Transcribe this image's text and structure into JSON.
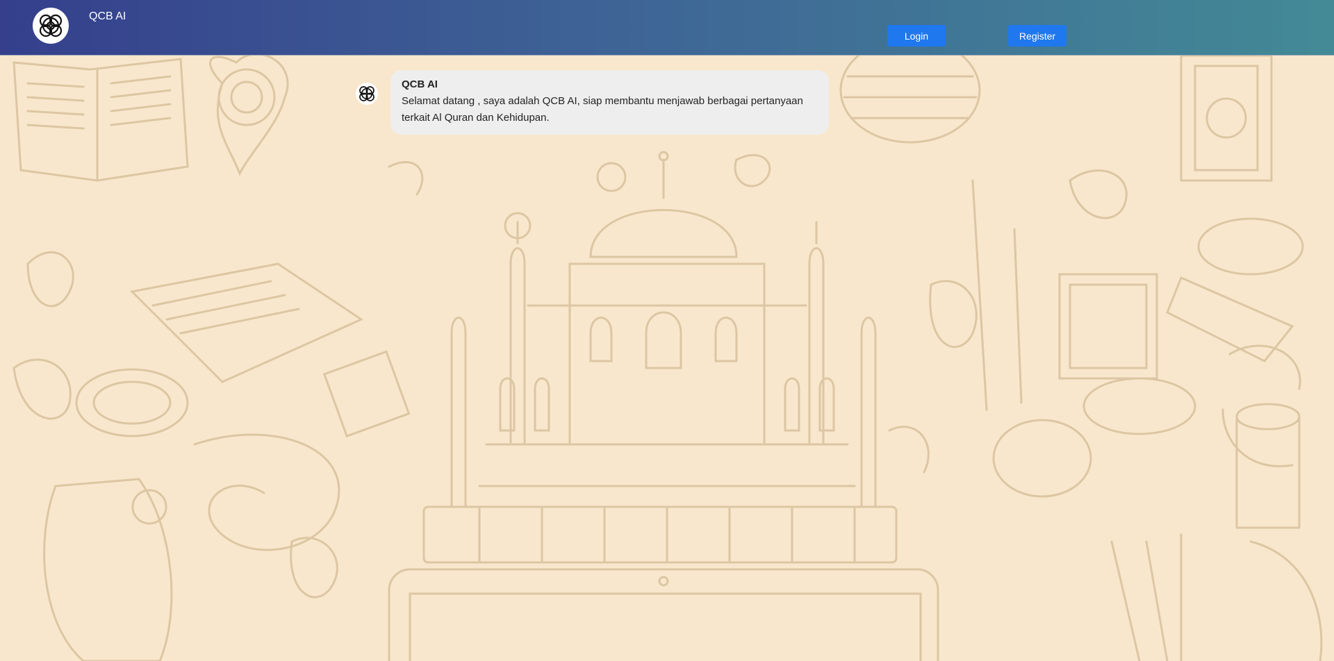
{
  "header": {
    "app_title": "QCB AI",
    "logo_icon": "knot-logo-icon",
    "login_label": "Login",
    "register_label": "Register",
    "gradient_colors": [
      "#353f8c",
      "#3e6396",
      "#438a96"
    ],
    "button_color": "#1f78ee"
  },
  "chat": {
    "messages": [
      {
        "sender": "QCB AI",
        "avatar_icon": "knot-logo-icon",
        "text": "Selamat datang , saya adalah QCB AI, siap membantu menjawab berbagai pertanyaan terkait Al Quran dan Kehidupan."
      }
    ]
  },
  "background": {
    "color": "#f8e7cc",
    "illustration": "sketch-pattern"
  }
}
